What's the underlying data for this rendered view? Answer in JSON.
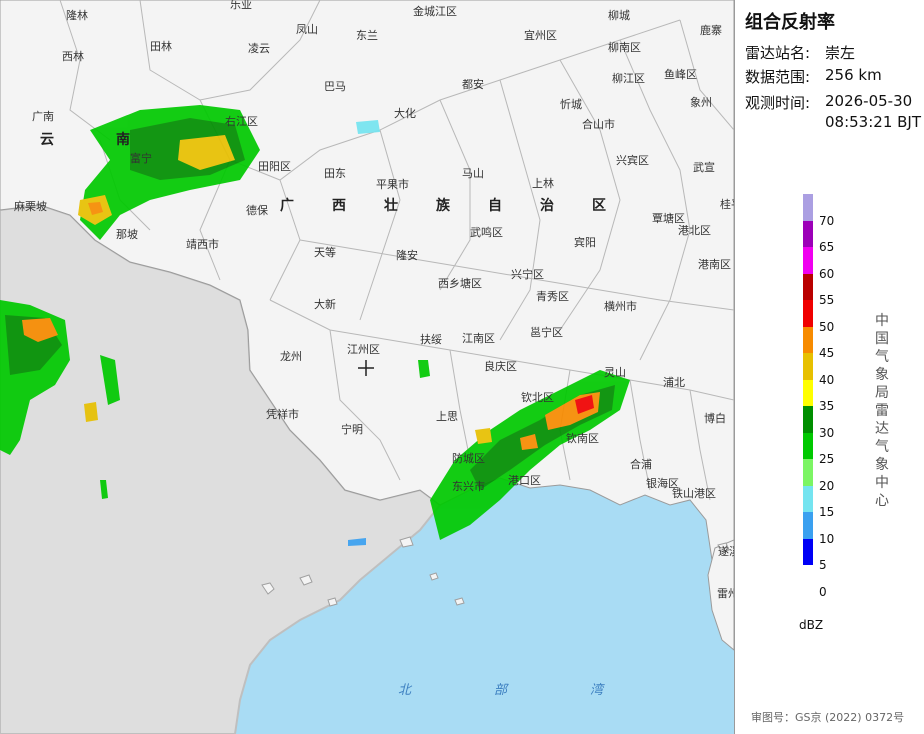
{
  "panel": {
    "title": "组合反射率",
    "station_label": "雷达站名:",
    "station_value": "崇左",
    "range_label": "数据范围:",
    "range_value": "256 km",
    "time_label": "观测时间:",
    "time_date": "2026-05-30",
    "time_clock": "08:53:21 BJT",
    "unit": "dBZ",
    "org_vertical": "中国气象局雷达气象中心",
    "approval": "审图号：GS京 (2022) 0372号"
  },
  "legend": [
    {
      "value": "70",
      "color": "#ab9fe2"
    },
    {
      "value": "65",
      "color": "#9c00b8"
    },
    {
      "value": "60",
      "color": "#f000f0"
    },
    {
      "value": "55",
      "color": "#b90000"
    },
    {
      "value": "50",
      "color": "#f00000"
    },
    {
      "value": "45",
      "color": "#f78b00"
    },
    {
      "value": "40",
      "color": "#e7c000"
    },
    {
      "value": "35",
      "color": "#ffff00"
    },
    {
      "value": "30",
      "color": "#008f00"
    },
    {
      "value": "25",
      "color": "#00c900"
    },
    {
      "value": "20",
      "color": "#7cf564"
    },
    {
      "value": "15",
      "color": "#74e4f0"
    },
    {
      "value": "10",
      "color": "#3aa0f0"
    },
    {
      "value": "5",
      "color": "#0000f6"
    },
    {
      "value": "0",
      "color": "#ffffff"
    }
  ],
  "map": {
    "sea_name": "北部湾",
    "region_name": "广西壮族自治区",
    "province_yunnan": "云南",
    "places": [
      "隆林",
      "乐业",
      "金城江区",
      "柳城",
      "鹿寨",
      "西林",
      "田林",
      "凌云",
      "凤山",
      "东兰",
      "宜州区",
      "柳南区",
      "鱼峰区",
      "柳江区",
      "象州",
      "巴马",
      "都安",
      "忻城",
      "合山市",
      "广南",
      "右江区",
      "富宁",
      "田阳区",
      "大化",
      "兴宾区",
      "武宣",
      "田东",
      "平果市",
      "马山",
      "上林",
      "麻栗坡",
      "德保",
      "武鸣区",
      "宾阳",
      "覃塘区",
      "港北区",
      "桂平市",
      "那坡",
      "靖西市",
      "天等",
      "隆安",
      "兴宁区",
      "西乡塘区",
      "青秀区",
      "横州市",
      "港南区",
      "大新",
      "扶绥",
      "江南区",
      "邕宁区",
      "龙州",
      "江州区",
      "良庆区",
      "灵山",
      "浦北",
      "博白",
      "凭祥市",
      "宁明",
      "上思",
      "钦北区",
      "钦南区",
      "合浦",
      "防城区",
      "东兴市",
      "港口区",
      "银海区",
      "铁山港区",
      "遂溪",
      "雷州市"
    ]
  }
}
